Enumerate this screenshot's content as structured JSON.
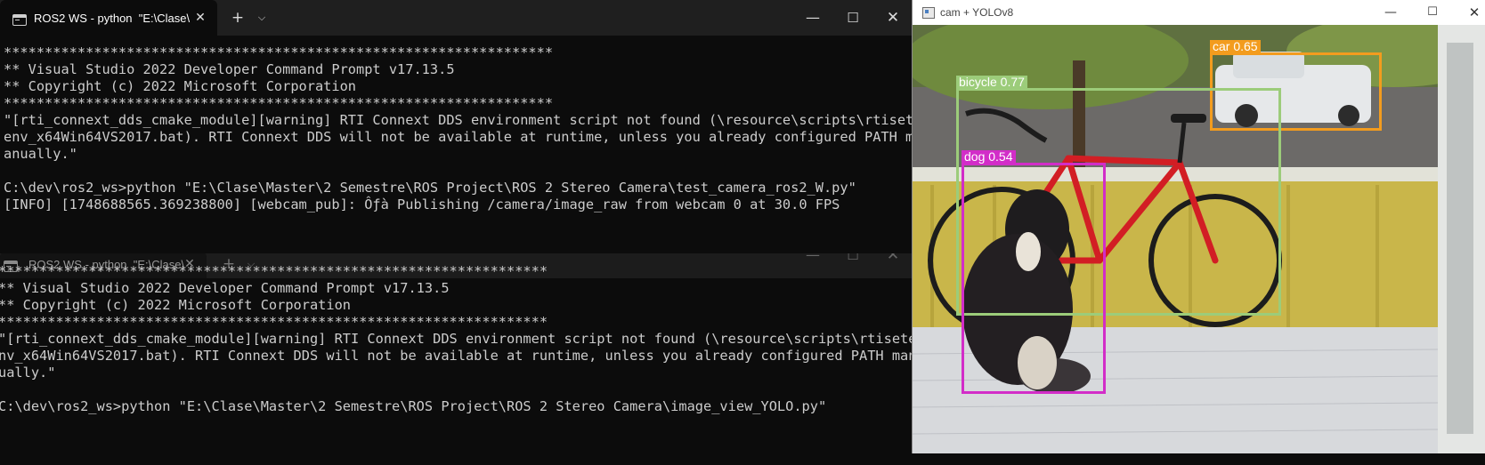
{
  "terminal_top": {
    "tab_title": "ROS2 WS - python  \"E:\\Clase\\",
    "tab_icon": "terminal-icon",
    "close_tab_glyph": "✕",
    "new_tab_glyph": "+",
    "dropdown_glyph": "⌵",
    "minimize_glyph": "—",
    "maximize_glyph": "☐",
    "close_glyph": "✕",
    "output": "*******************************************************************\n** Visual Studio 2022 Developer Command Prompt v17.13.5\n** Copyright (c) 2022 Microsoft Corporation\n*******************************************************************\n\"[rti_connext_dds_cmake_module][warning] RTI Connext DDS environment script not found (\\resource\\scripts\\rtiset\nenv_x64Win64VS2017.bat). RTI Connext DDS will not be available at runtime, unless you already configured PATH m\nanually.\"\n\nC:\\dev\\ros2_ws>python \"E:\\Clase\\Master\\2 Semestre\\ROS Project\\ROS 2 Stereo Camera\\test_camera_ros2_W.py\"\n[INFO] [1748688565.369238800] [webcam_pub]: Ôƒà Publishing /camera/image_raw from webcam 0 at 30.0 FPS"
  },
  "terminal_bottom": {
    "tab_title": "ROS2 WS - python  \"E:\\Clase\\",
    "tab_icon": "terminal-icon",
    "close_tab_glyph": "✕",
    "new_tab_glyph": "+",
    "dropdown_glyph": "⌵",
    "minimize_glyph": "—",
    "maximize_glyph": "☐",
    "close_glyph": "✕",
    "output": "*******************************************************************\n** Visual Studio 2022 Developer Command Prompt v17.13.5\n** Copyright (c) 2022 Microsoft Corporation\n*******************************************************************\n\"[rti_connext_dds_cmake_module][warning] RTI Connext DDS environment script not found (\\resource\\scripts\\rtisete\nnv_x64Win64VS2017.bat). RTI Connext DDS will not be available at runtime, unless you already configured PATH man\nually.\"\n\nC:\\dev\\ros2_ws>python \"E:\\Clase\\Master\\2 Semestre\\ROS Project\\ROS 2 Stereo Camera\\image_view_YOLO.py\""
  },
  "viewer": {
    "title": "cam + YOLOv8",
    "minimize_glyph": "—",
    "maximize_glyph": "☐",
    "close_glyph": "✕",
    "detections": [
      {
        "label": "car 0.65",
        "class": "car",
        "confidence": 0.65,
        "color": "#f39c1e"
      },
      {
        "label": "bicycle 0.77",
        "class": "bicycle",
        "confidence": 0.77,
        "color": "#9ccc7a"
      },
      {
        "label": "dog 0.54",
        "class": "dog",
        "confidence": 0.54,
        "color": "#d22dc8"
      }
    ]
  }
}
